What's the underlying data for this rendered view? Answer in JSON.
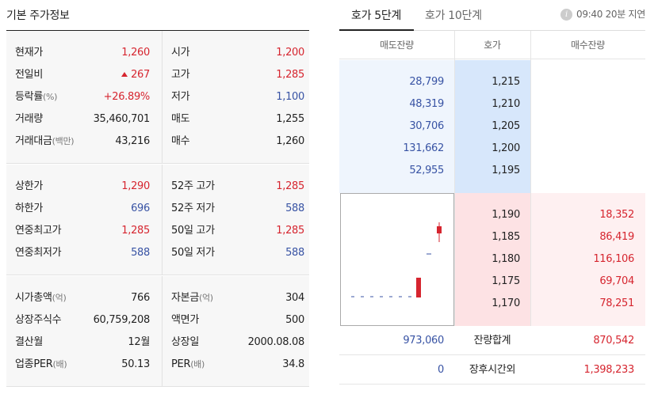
{
  "left": {
    "title": "기본 주가정보",
    "block1": [
      {
        "k1": "현재가",
        "u1": "",
        "v1": "1,260",
        "c1": "red",
        "k2": "시가",
        "u2": "",
        "v2": "1,200",
        "c2": "red"
      },
      {
        "k1": "전일비",
        "u1": "",
        "v1": "267",
        "c1": "red",
        "k2": "고가",
        "u2": "",
        "v2": "1,285",
        "c2": "red"
      },
      {
        "k1": "등락률",
        "u1": "(%)",
        "v1": "+26.89%",
        "c1": "red",
        "k2": "저가",
        "u2": "",
        "v2": "1,100",
        "c2": "blue"
      },
      {
        "k1": "거래량",
        "u1": "",
        "v1": "35,460,701",
        "c1": "",
        "k2": "매도",
        "u2": "",
        "v2": "1,255",
        "c2": ""
      },
      {
        "k1": "거래대금",
        "u1": "(백만)",
        "v1": "43,216",
        "c1": "",
        "k2": "매수",
        "u2": "",
        "v2": "1,260",
        "c2": ""
      }
    ],
    "block2": [
      {
        "k1": "상한가",
        "u1": "",
        "v1": "1,290",
        "c1": "red",
        "k2": "52주 고가",
        "u2": "",
        "v2": "1,285",
        "c2": "red"
      },
      {
        "k1": "하한가",
        "u1": "",
        "v1": "696",
        "c1": "blue",
        "k2": "52주 저가",
        "u2": "",
        "v2": "588",
        "c2": "blue"
      },
      {
        "k1": "연중최고가",
        "u1": "",
        "v1": "1,285",
        "c1": "red",
        "k2": "50일 고가",
        "u2": "",
        "v2": "1,285",
        "c2": "red"
      },
      {
        "k1": "연중최저가",
        "u1": "",
        "v1": "588",
        "c1": "blue",
        "k2": "50일 저가",
        "u2": "",
        "v2": "588",
        "c2": "blue"
      }
    ],
    "block3": [
      {
        "k1": "시가총액",
        "u1": "(억)",
        "v1": "766",
        "c1": "",
        "k2": "자본금",
        "u2": "(억)",
        "v2": "304",
        "c2": ""
      },
      {
        "k1": "상장주식수",
        "u1": "",
        "v1": "60,759,208",
        "c1": "",
        "k2": "액면가",
        "u2": "",
        "v2": "500",
        "c2": ""
      },
      {
        "k1": "결산월",
        "u1": "",
        "v1": "12월",
        "c1": "",
        "k2": "상장일",
        "u2": "",
        "v2": "2000.08.08",
        "c2": ""
      },
      {
        "k1": "업종PER",
        "u1": "(배)",
        "v1": "50.13",
        "c1": "",
        "k2": "PER",
        "u2": "(배)",
        "v2": "34.8",
        "c2": ""
      }
    ]
  },
  "right": {
    "tabs": [
      "호가 5단계",
      "호가 10단계"
    ],
    "info": "09:40 20분 지연",
    "info_icon": "i",
    "headers": [
      "매도잔량",
      "호가",
      "매수잔량"
    ],
    "asks": [
      {
        "vol": "28,799",
        "price": "1,215"
      },
      {
        "vol": "48,319",
        "price": "1,210"
      },
      {
        "vol": "30,706",
        "price": "1,205"
      },
      {
        "vol": "131,662",
        "price": "1,200"
      },
      {
        "vol": "52,955",
        "price": "1,195"
      }
    ],
    "bids": [
      {
        "price": "1,190",
        "vol": "18,352"
      },
      {
        "price": "1,185",
        "vol": "86,419"
      },
      {
        "price": "1,180",
        "vol": "116,106"
      },
      {
        "price": "1,175",
        "vol": "69,704"
      },
      {
        "price": "1,170",
        "vol": "78,251"
      }
    ],
    "summary": [
      {
        "ask": "973,060",
        "label": "잔량합계",
        "bid": "870,542"
      },
      {
        "ask": "0",
        "label": "장후시간외",
        "bid": "1,398,233"
      }
    ]
  },
  "colors": {
    "up": "#d6252f",
    "down": "#3853a4"
  }
}
